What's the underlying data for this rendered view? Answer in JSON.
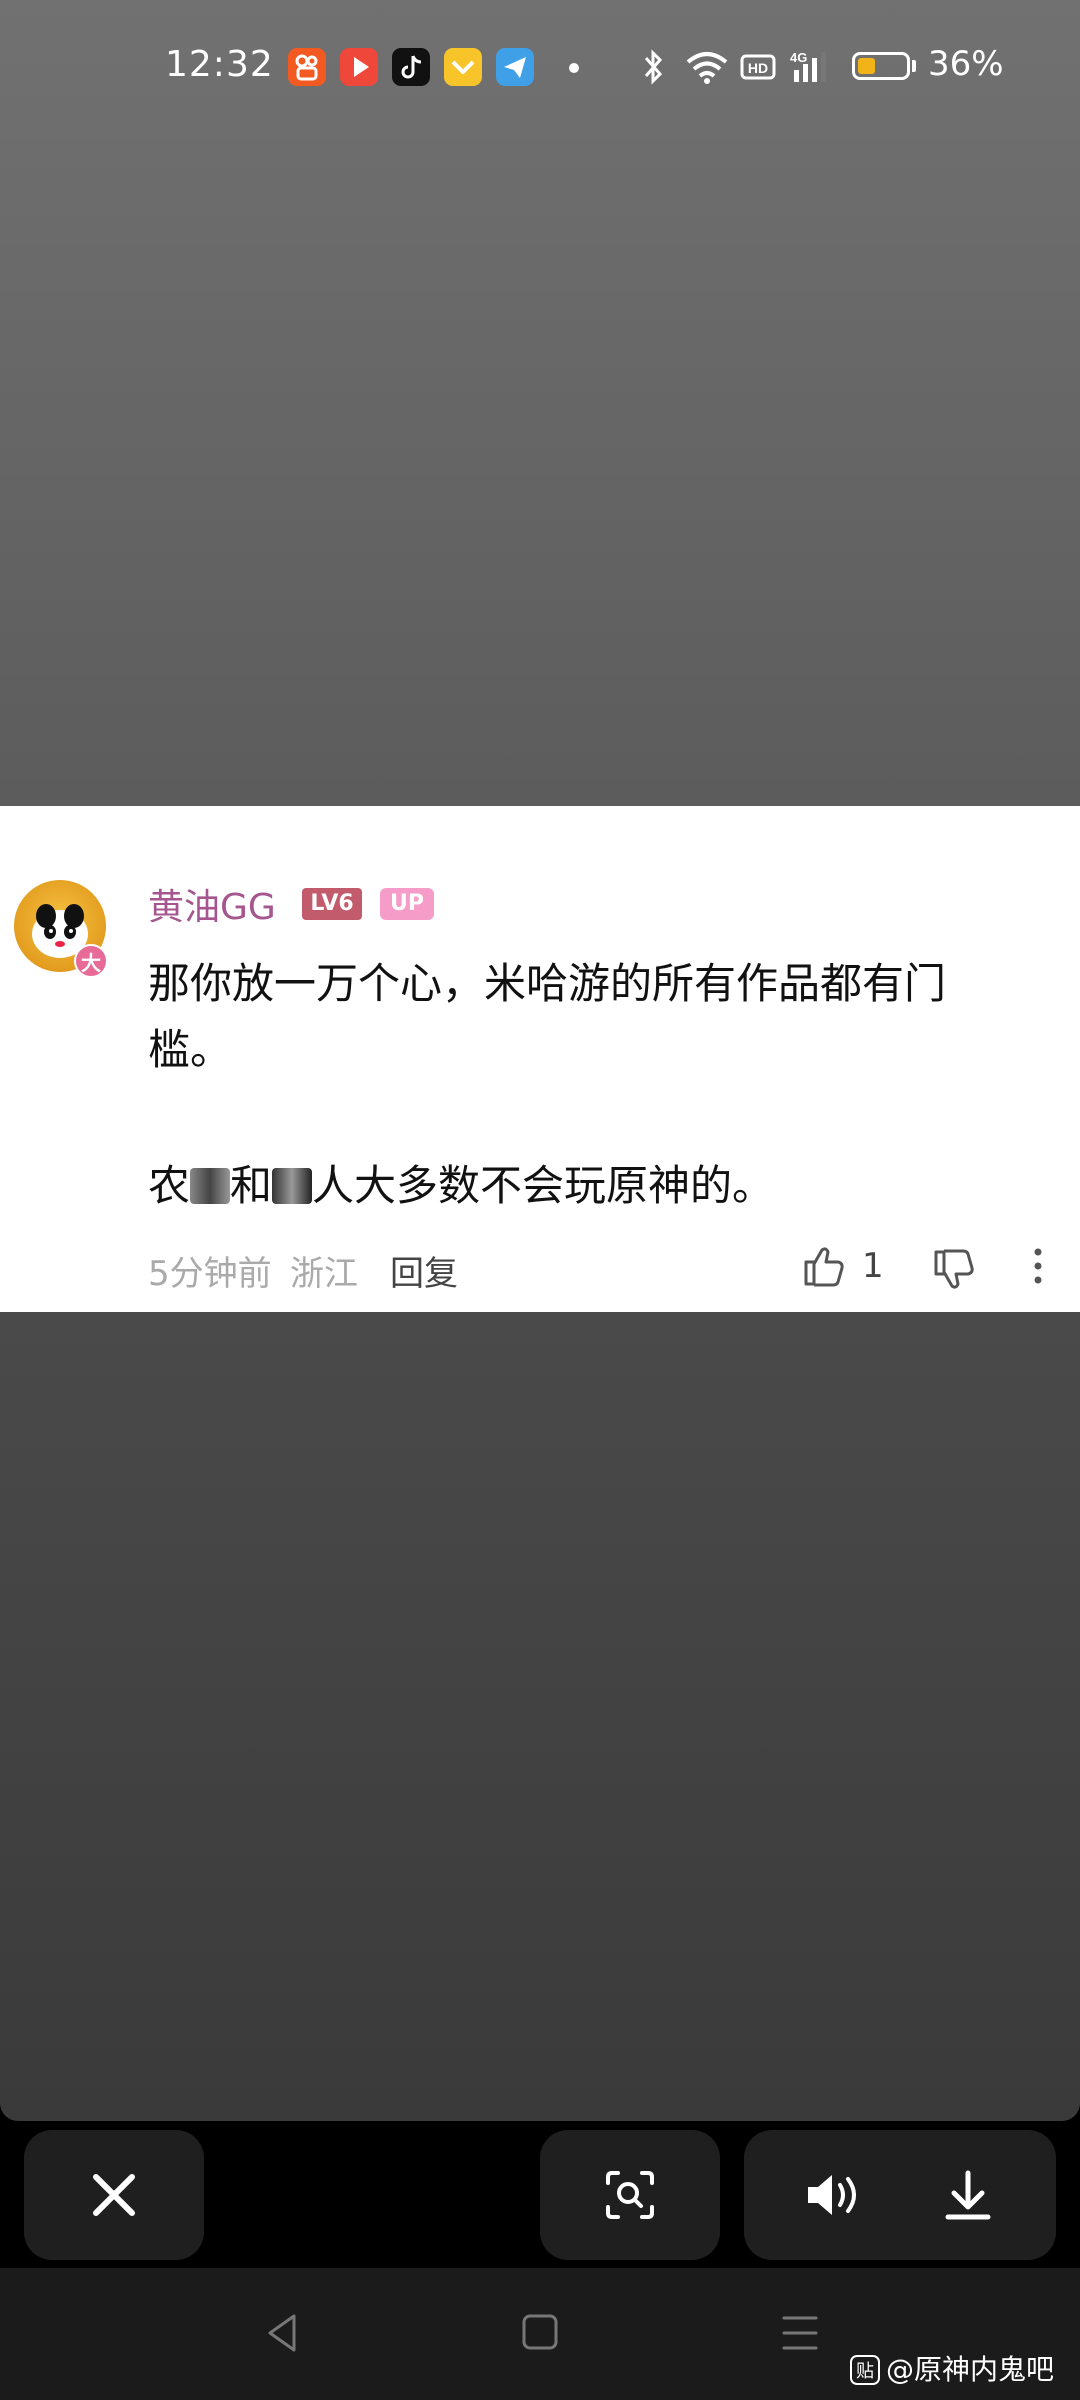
{
  "status_bar": {
    "time": "12:32",
    "battery_percent": "36%",
    "battery_level": 0.36,
    "app_icons": [
      "kuaishou-icon",
      "video-player-icon",
      "tiktok-icon",
      "vip-crown-icon",
      "telegram-icon"
    ],
    "system_icons": [
      "bluetooth-icon",
      "wifi-icon",
      "hd-icon",
      "4g-signal-icon",
      "battery-icon"
    ]
  },
  "comment": {
    "username": "黄油GG",
    "level_badge": "LV6",
    "up_badge": "UP",
    "avatar_badge": "大",
    "line1": "那你放一万个心，米哈游的所有作品都有门",
    "line2": "槛。",
    "line3_part1": "农",
    "line3_part2": "和",
    "line3_part3": "人大多数不会玩原神的。",
    "time_ago": "5分钟前",
    "location": "浙江",
    "reply_label": "回复",
    "like_count": "1"
  },
  "bottom_bar": {
    "close_icon": "close-icon",
    "scan_icon": "image-search-icon",
    "sound_icon": "volume-icon",
    "download_icon": "download-icon"
  },
  "watermark": {
    "icon_text": "贴",
    "text": "@原神内鬼吧"
  },
  "colors": {
    "username": "#a6568f",
    "level_badge": "#c25c6d",
    "up_badge": "#f59cc8",
    "battery_fill": "#f2b319"
  }
}
